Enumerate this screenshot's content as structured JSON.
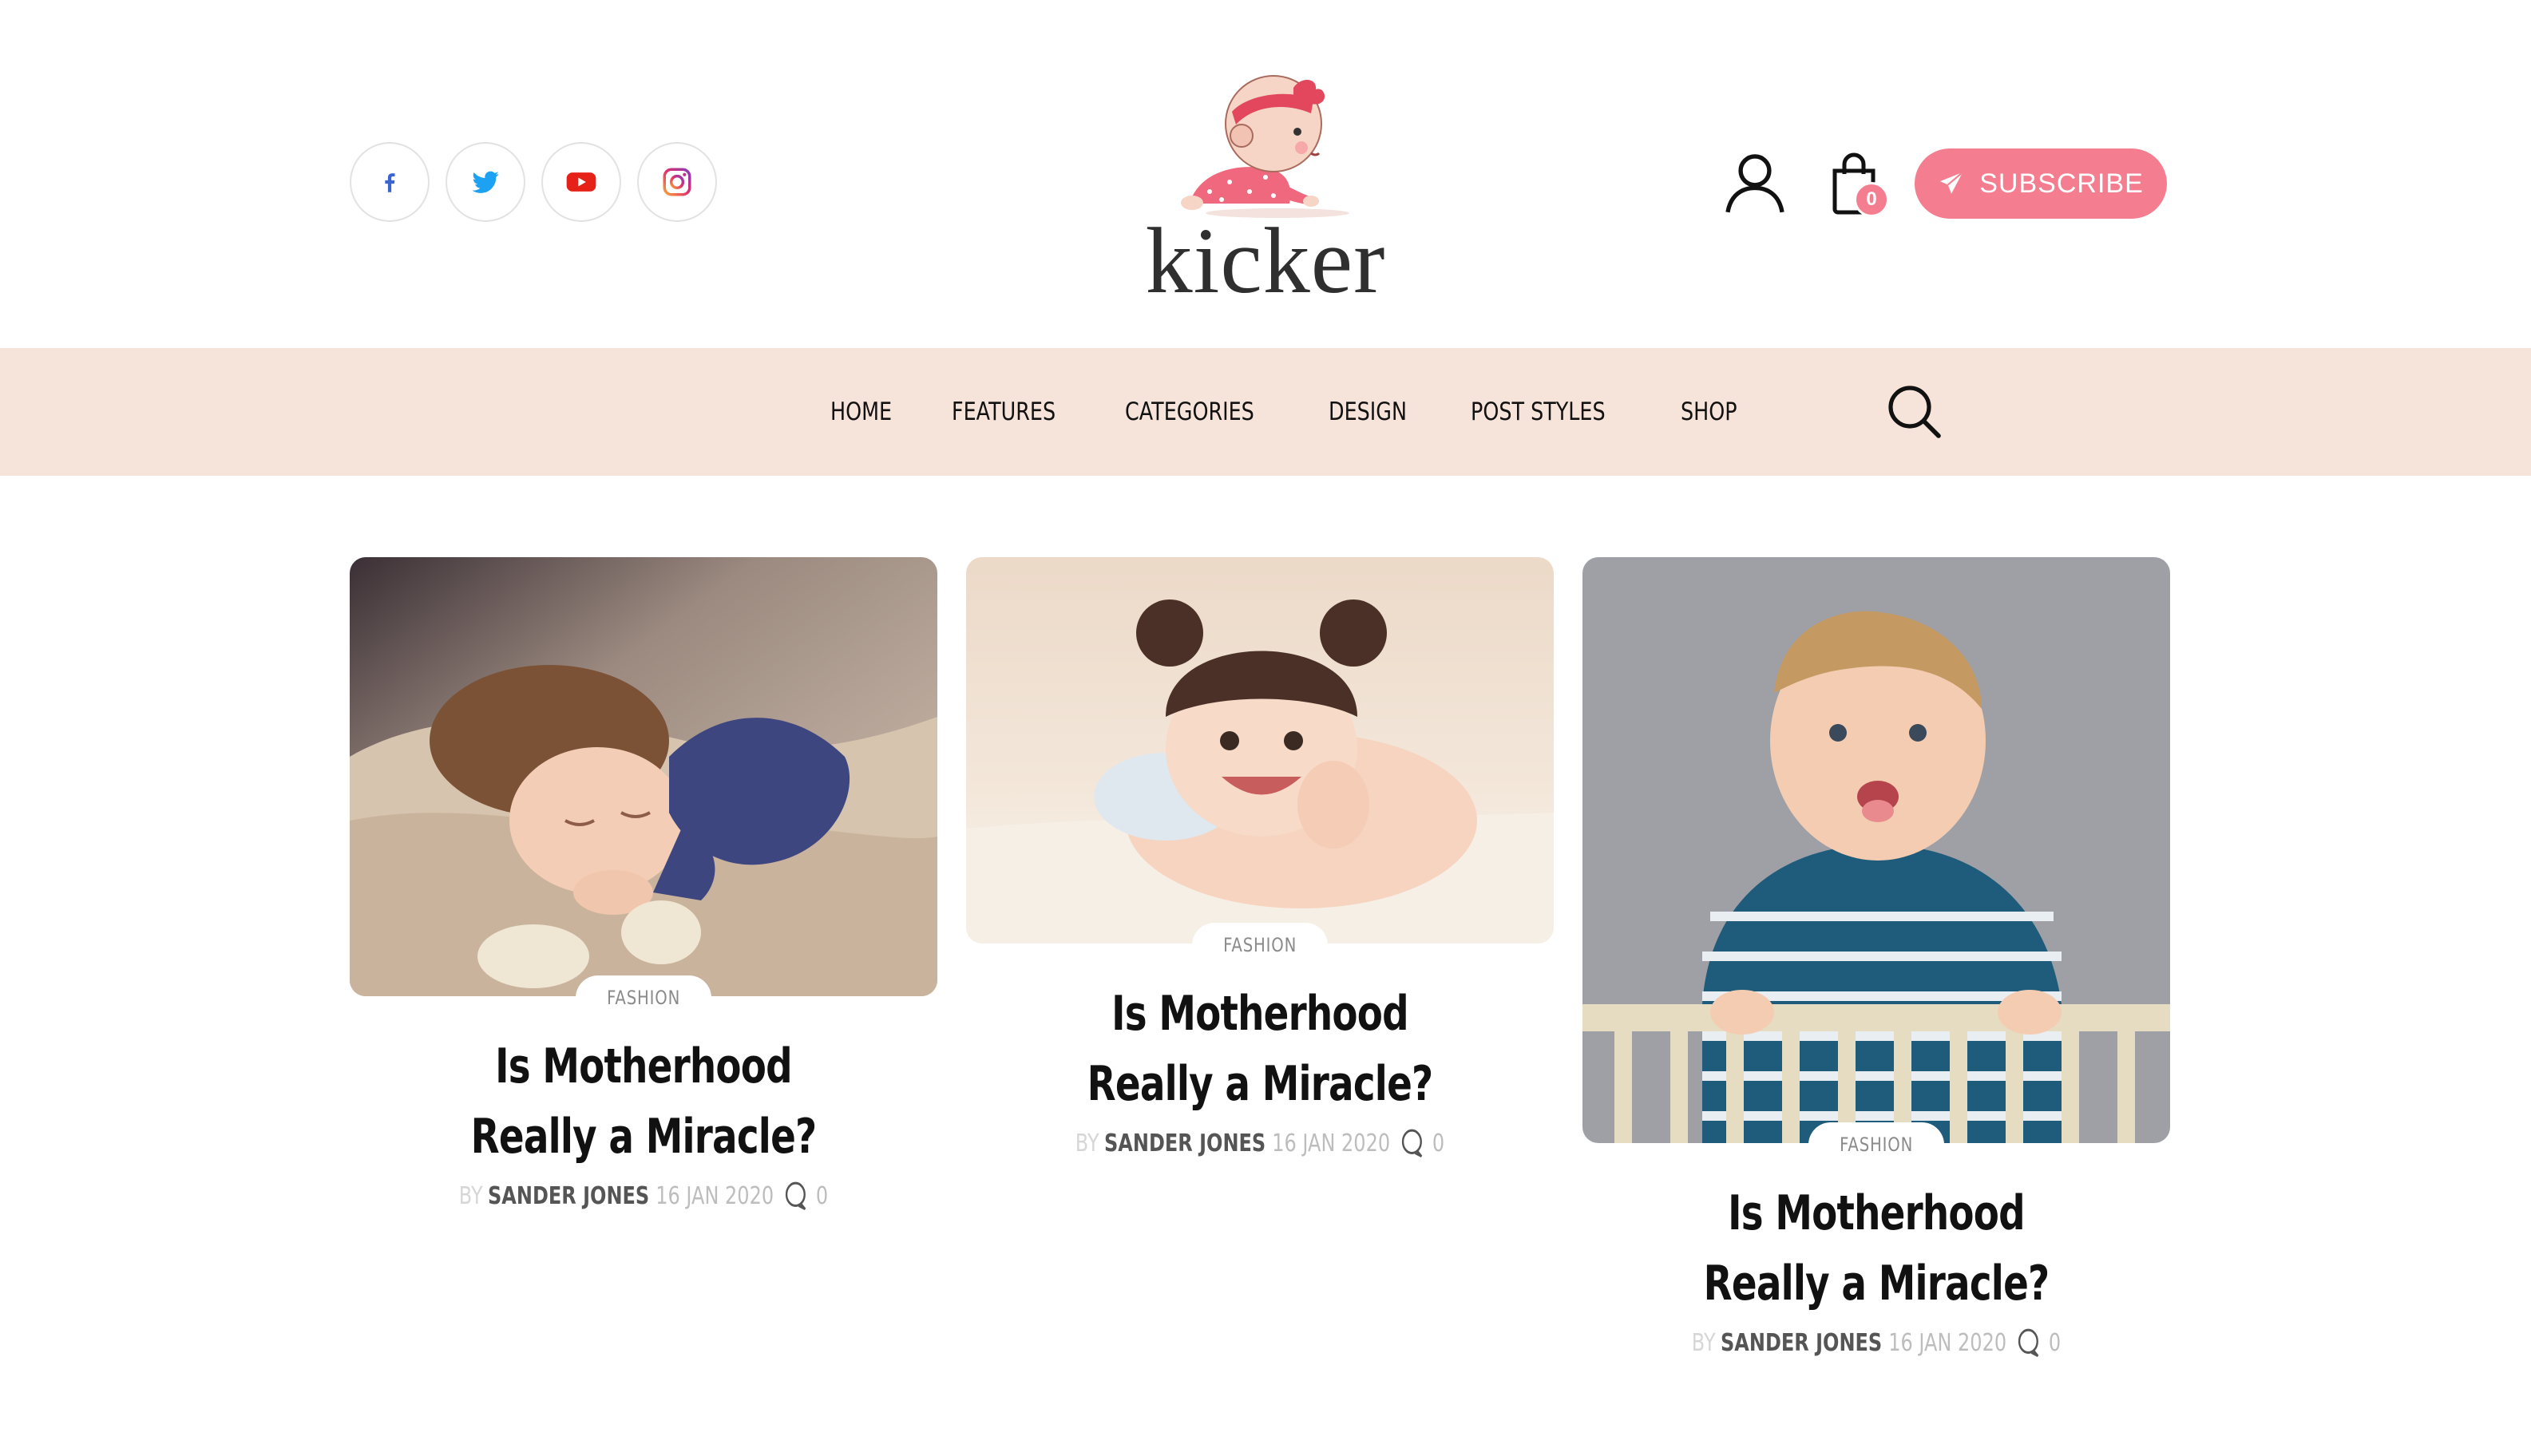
{
  "brand": {
    "name": "kicker",
    "accent_color": "#f47e8f",
    "nav_bg_color": "#f6e3da"
  },
  "header": {
    "socials": [
      {
        "icon": "facebook-icon"
      },
      {
        "icon": "twitter-icon"
      },
      {
        "icon": "youtube-icon"
      },
      {
        "icon": "instagram-icon"
      }
    ],
    "cart_count": "0",
    "subscribe_label": "SUBSCRIBE"
  },
  "nav": {
    "items": [
      "HOME",
      "FEATURES",
      "CATEGORIES",
      "DESIGN",
      "POST STYLES",
      "SHOP"
    ]
  },
  "posts": [
    {
      "category": "FASHION",
      "title": "Is Motherhood Really a Miracle?",
      "by": "BY",
      "author": "SANDER JONES",
      "date": "16 JAN 2020",
      "comments": "0"
    },
    {
      "category": "FASHION",
      "title": "Is Motherhood Really a Miracle?",
      "by": "BY",
      "author": "SANDER JONES",
      "date": "16 JAN 2020",
      "comments": "0"
    },
    {
      "category": "FASHION",
      "title": "Is Motherhood Really a Miracle?",
      "by": "BY",
      "author": "SANDER JONES",
      "date": "16 JAN 2020",
      "comments": "0"
    }
  ]
}
